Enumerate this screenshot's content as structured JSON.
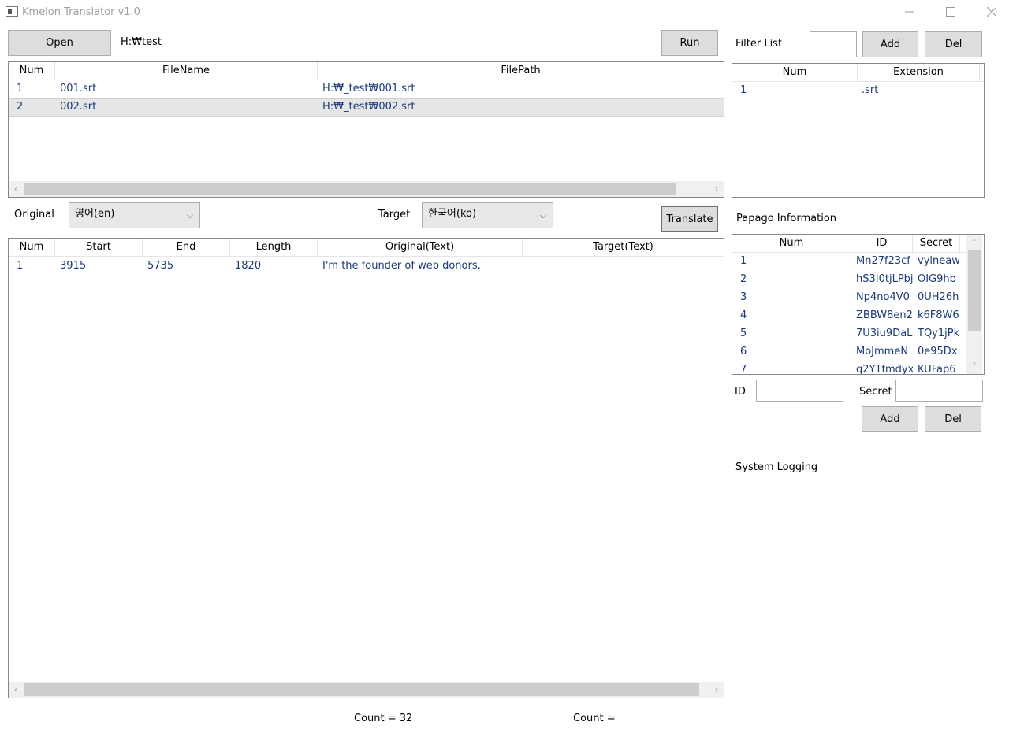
{
  "window": {
    "title": "Kmelon Translator v1.0"
  },
  "toolbar": {
    "open_label": "Open",
    "path": "H:₩test",
    "run_label": "Run"
  },
  "files": {
    "columns": [
      "Num",
      "FileName",
      "FilePath"
    ],
    "rows": [
      {
        "num": "1",
        "name": "001.srt",
        "path": "H:₩_test₩001.srt"
      },
      {
        "num": "2",
        "name": "002.srt",
        "path": "H:₩_test₩002.srt"
      }
    ],
    "selected_index": 1
  },
  "lang": {
    "original_label": "Original",
    "original_value": "영어(en)",
    "target_label": "Target",
    "target_value": "한국어(ko)",
    "translate_label": "Translate"
  },
  "subtitles": {
    "columns": [
      "Num",
      "Start",
      "End",
      "Length",
      "Original(Text)",
      "Target(Text)"
    ],
    "rows": [
      {
        "num": "1",
        "start": "3915",
        "end": "5735",
        "length": "1820",
        "original": "I'm the founder of web donors,",
        "target": ""
      }
    ]
  },
  "counts": {
    "left": "Count  =  32",
    "right": "Count  ="
  },
  "filter": {
    "title": "Filter List",
    "add_label": "Add",
    "del_label": "Del",
    "columns": [
      "Num",
      "Extension"
    ],
    "rows": [
      {
        "num": "1",
        "ext": ".srt"
      }
    ]
  },
  "papago": {
    "title": "Papago Information",
    "columns": [
      "Num",
      "ID",
      "Secret"
    ],
    "rows": [
      {
        "num": "1",
        "id": "Mn27f23cf",
        "secret": "vylneaw"
      },
      {
        "num": "2",
        "id": "hS3I0tjLPbj",
        "secret": "OIG9hb"
      },
      {
        "num": "3",
        "id": "Np4no4V0",
        "secret": "0UH26h"
      },
      {
        "num": "4",
        "id": "ZBBW8en2",
        "secret": "k6F8W6"
      },
      {
        "num": "5",
        "id": "7U3iu9DaL",
        "secret": "TQy1jPk"
      },
      {
        "num": "6",
        "id": "MoJmmeN",
        "secret": "0e95Dx"
      },
      {
        "num": "7",
        "id": "q2YTfmdyx",
        "secret": "KUFap6"
      }
    ],
    "id_label": "ID",
    "secret_label": "Secret",
    "add_label": "Add",
    "del_label": "Del"
  },
  "logging": {
    "title": "System Logging"
  }
}
